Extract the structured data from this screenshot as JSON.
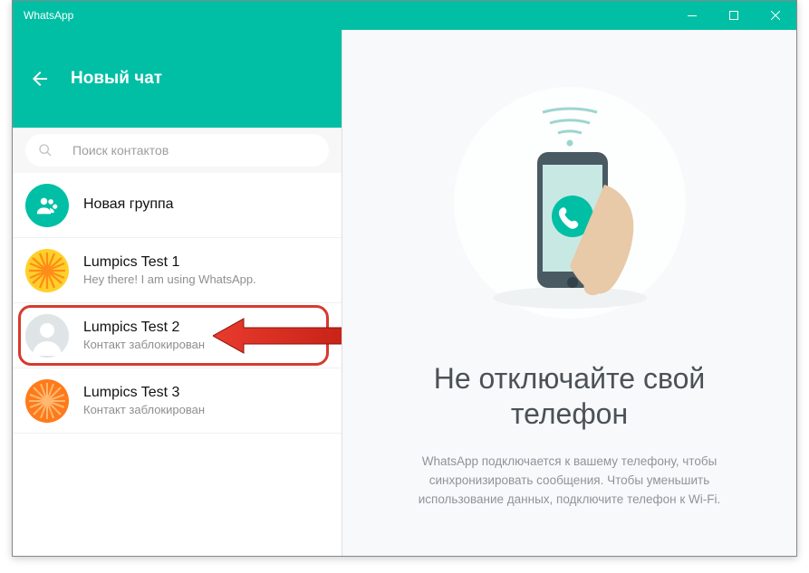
{
  "title": "WhatsApp",
  "header": {
    "title": "Новый чат"
  },
  "search": {
    "placeholder": "Поиск контактов"
  },
  "newgroup": {
    "label": "Новая группа"
  },
  "contacts": [
    {
      "name": "Lumpics Test 1",
      "status": "Hey there! I am using WhatsApp.",
      "avatar": "orange1",
      "highlighted": false
    },
    {
      "name": "Lumpics Test 2",
      "status": "Контакт заблокирован",
      "avatar": "default",
      "highlighted": true
    },
    {
      "name": "Lumpics Test 3",
      "status": "Контакт заблокирован",
      "avatar": "orange2",
      "highlighted": false
    }
  ],
  "main": {
    "title": "Не отключайте свой телефон",
    "subtitle": "WhatsApp подключается к вашему телефону, чтобы синхронизировать сообщения. Чтобы уменьшить использование данных, подключите телефон к Wi-Fi."
  },
  "colors": {
    "accent": "#00bfa5",
    "highlight": "#d63a2f"
  }
}
